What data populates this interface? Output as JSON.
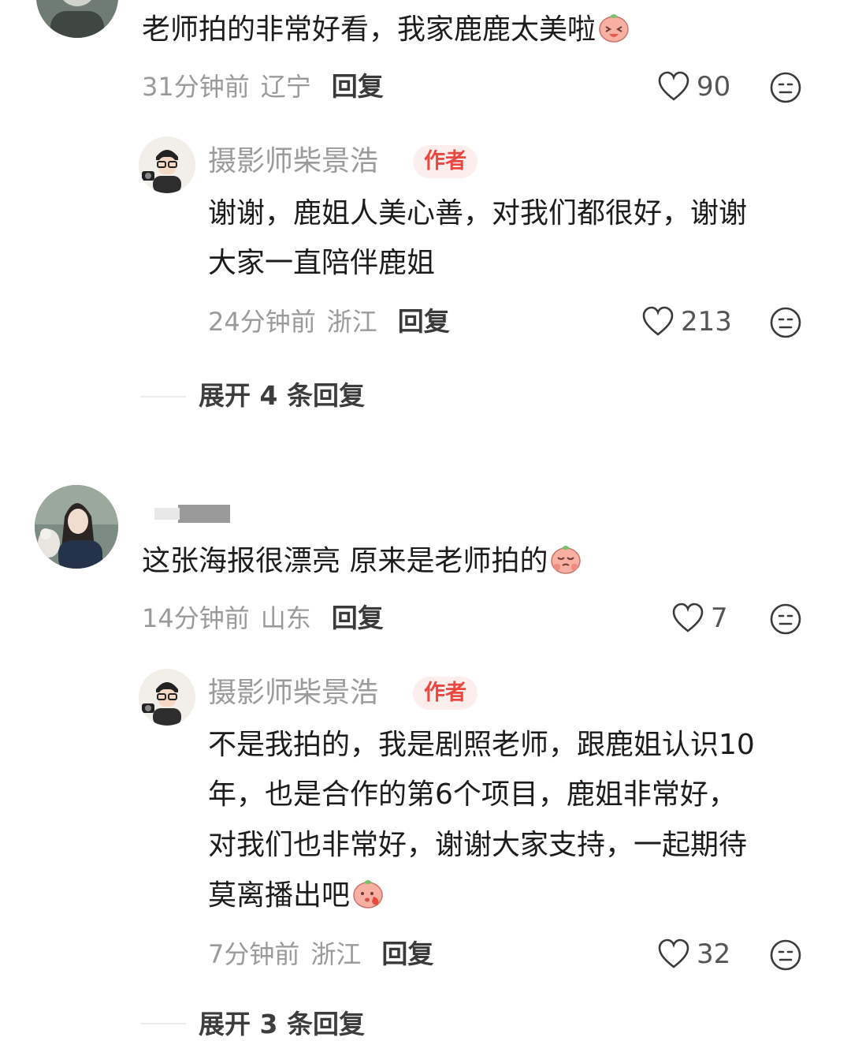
{
  "comments": [
    {
      "text": "老师拍的非常好看，我家鹿鹿太美啦",
      "time": "31分钟前",
      "location": "辽宁",
      "reply_label": "回复",
      "likes": "90",
      "reply": {
        "author": "摄影师柴景浩",
        "tag": "作者",
        "lines": [
          "谢谢，鹿姐人美心善，对我们都很好，谢谢",
          "大家一直陪伴鹿姐"
        ],
        "time": "24分钟前",
        "location": "浙江",
        "reply_label": "回复",
        "likes": "213"
      },
      "expand_label": "展开 4 条回复"
    },
    {
      "text": "这张海报很漂亮 原来是老师拍的",
      "time": "14分钟前",
      "location": "山东",
      "reply_label": "回复",
      "likes": "7",
      "reply": {
        "author": "摄影师柴景浩",
        "tag": "作者",
        "lines": [
          "不是我拍的，我是剧照老师，跟鹿姐认识10",
          "年，也是合作的第6个项目，鹿姐非常好，",
          "对我们也非常好，谢谢大家支持，一起期待",
          "莫离播出吧"
        ],
        "time": "7分钟前",
        "location": "浙江",
        "reply_label": "回复",
        "likes": "32"
      },
      "expand_label": "展开 3 条回复"
    }
  ],
  "colors": {
    "author_tag_text": "#e9473f",
    "author_tag_bg": "#fdeeee",
    "meta": "#9a9a9a"
  }
}
